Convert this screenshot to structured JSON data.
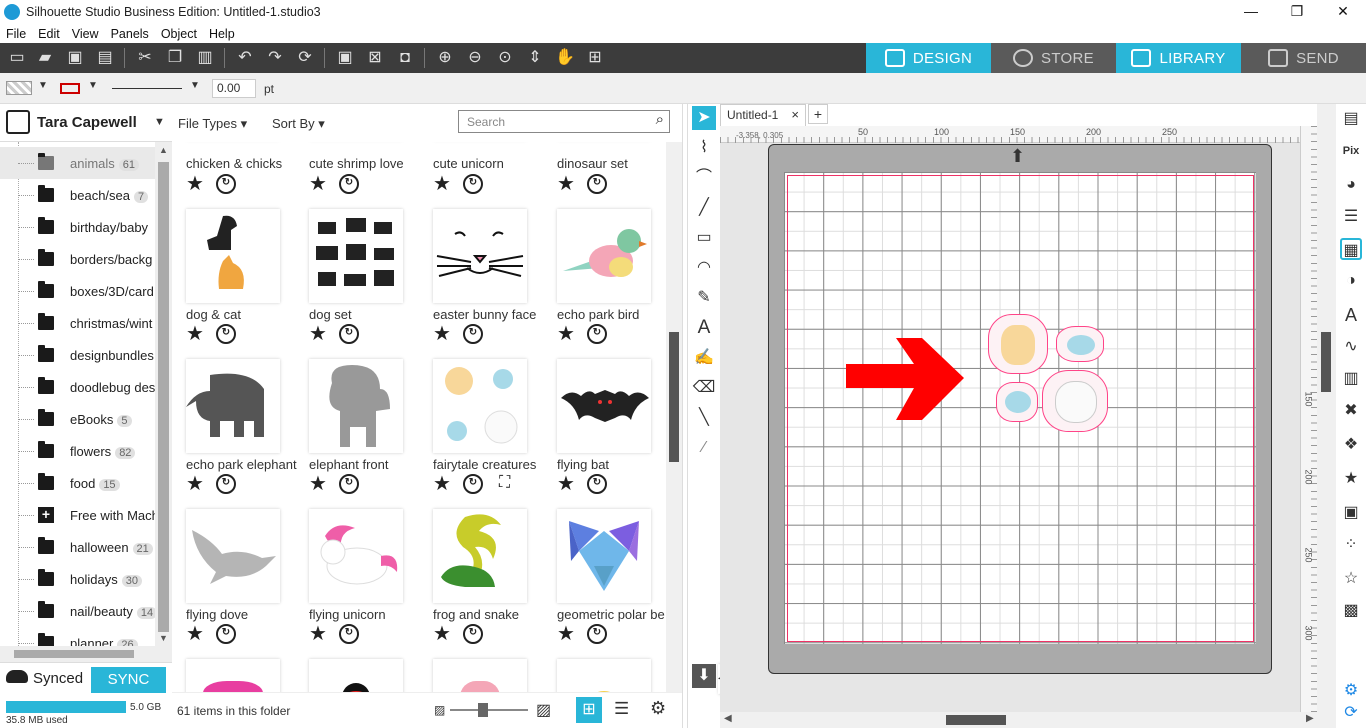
{
  "window": {
    "title": "Silhouette Studio Business Edition: Untitled-1.studio3",
    "minimize": "—",
    "maximize": "❐",
    "close": "✕"
  },
  "menu": [
    "File",
    "Edit",
    "View",
    "Panels",
    "Object",
    "Help"
  ],
  "nav_tabs": {
    "design": "DESIGN",
    "store": "STORE",
    "library": "LIBRARY",
    "send": "SEND"
  },
  "props": {
    "line_width": "0.00",
    "unit": "pt"
  },
  "user": {
    "name": "Tara Capewell"
  },
  "folders": [
    {
      "label": "animals",
      "count": "61"
    },
    {
      "label": "beach/sea",
      "count": "7"
    },
    {
      "label": "birthday/baby",
      "count": ""
    },
    {
      "label": "borders/backg",
      "count": ""
    },
    {
      "label": "boxes/3D/card",
      "count": ""
    },
    {
      "label": "christmas/wint",
      "count": ""
    },
    {
      "label": "designbundles",
      "count": ""
    },
    {
      "label": "doodlebug des",
      "count": ""
    },
    {
      "label": "eBooks",
      "count": "5"
    },
    {
      "label": "flowers",
      "count": "82"
    },
    {
      "label": "food",
      "count": "15"
    },
    {
      "label": "Free with Mach",
      "count": ""
    },
    {
      "label": "halloween",
      "count": "21"
    },
    {
      "label": "holidays",
      "count": "30"
    },
    {
      "label": "nail/beauty",
      "count": "14"
    },
    {
      "label": "planner",
      "count": "26"
    }
  ],
  "sync": {
    "status": "Synced",
    "button": "SYNC",
    "capacity": "5.0 GB",
    "used": "35.8 MB used"
  },
  "library": {
    "file_types": "File Types",
    "sort_by": "Sort By",
    "search_placeholder": "Search",
    "items": [
      "chicken & chicks",
      "cute shrimp love",
      "cute unicorn",
      "dinosaur set",
      "dog & cat",
      "dog set",
      "easter bunny face",
      "echo park bird",
      "echo park elephant",
      "elephant front",
      "fairytale creatures",
      "flying bat",
      "flying dove",
      "flying unicorn",
      "frog and snake",
      "geometric polar be"
    ],
    "footer": "61 items in this folder"
  },
  "document": {
    "tab": "Untitled-1",
    "close": "×",
    "add": "+",
    "coords": "-3.358, 0.305"
  },
  "ruler": {
    "h": [
      "50",
      "100",
      "150",
      "200",
      "250"
    ],
    "v": [
      "150",
      "200",
      "250",
      "300"
    ]
  },
  "icons": {
    "accent": "#29b6d8",
    "dark": "#3c3c3c",
    "arrow": "#ff0000"
  }
}
